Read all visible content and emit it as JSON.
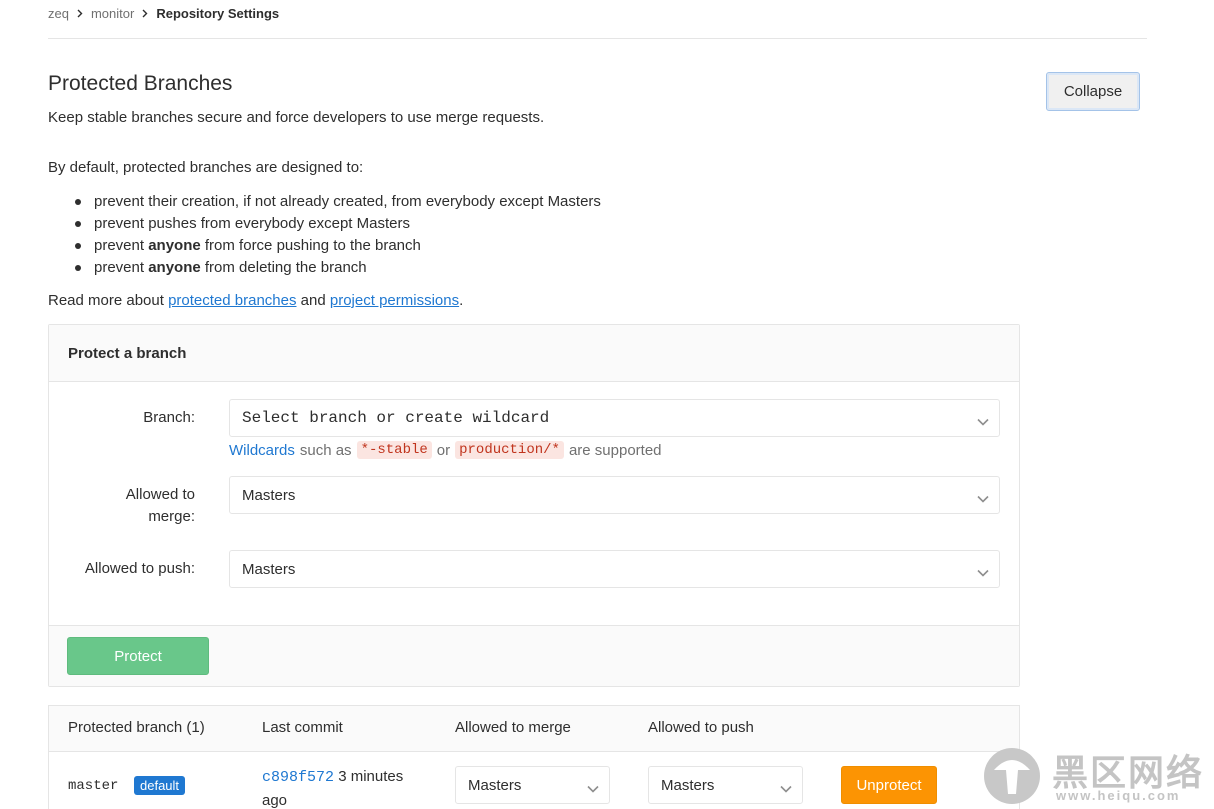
{
  "breadcrumb": {
    "items": [
      "zeq",
      "monitor"
    ],
    "current": "Repository Settings"
  },
  "section": {
    "title": "Protected Branches",
    "description": "Keep stable branches secure and force developers to use merge requests.",
    "collapse_label": "Collapse"
  },
  "intro": "By default, protected branches are designed to:",
  "bullets": [
    {
      "pre": "prevent their creation, if not already created, from everybody except Masters",
      "bold": "",
      "post": ""
    },
    {
      "pre": "prevent pushes from everybody except Masters",
      "bold": "",
      "post": ""
    },
    {
      "pre": "prevent ",
      "bold": "anyone",
      "post": " from force pushing to the branch"
    },
    {
      "pre": "prevent ",
      "bold": "anyone",
      "post": " from deleting the branch"
    }
  ],
  "readmore": {
    "prefix": "Read more about ",
    "link1": "protected branches",
    "middle": " and ",
    "link2": "project permissions",
    "suffix": "."
  },
  "protect_form": {
    "title": "Protect a branch",
    "branch_label": "Branch:",
    "branch_placeholder": "Select branch or create wildcard",
    "hint": {
      "link": "Wildcards",
      "text1": "such as",
      "code1": "*-stable",
      "text2": "or",
      "code2": "production/*",
      "text3": "are supported"
    },
    "merge_label_1": "Allowed to",
    "merge_label_2": "merge:",
    "merge_value": "Masters",
    "push_label": "Allowed to push:",
    "push_value": "Masters",
    "submit_label": "Protect"
  },
  "table": {
    "headers": [
      "Protected branch (1)",
      "Last commit",
      "Allowed to merge",
      "Allowed to push"
    ],
    "rows": [
      {
        "branch": "master",
        "badge": "default",
        "commit_sha": "c898f572",
        "commit_time": "3 minutes ago",
        "merge": "Masters",
        "push": "Masters",
        "action": "Unprotect"
      }
    ]
  },
  "watermark": {
    "text": "黑区网络",
    "url": "www.heiqu.com"
  },
  "colors": {
    "link": "#1f78d1",
    "protect": "#69c78a",
    "unprotect": "#fc9403",
    "badge": "#1f78d1"
  }
}
